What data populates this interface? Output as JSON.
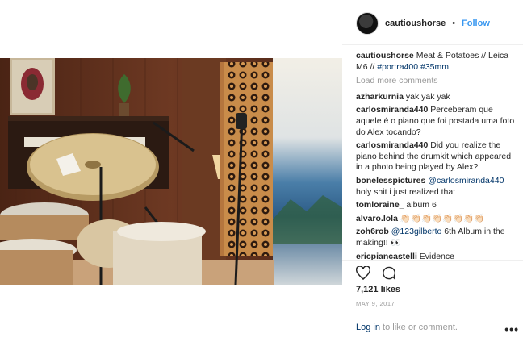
{
  "header": {
    "username": "cautioushorse",
    "separator": "•",
    "follow_label": "Follow"
  },
  "caption": {
    "username": "cautioushorse",
    "text_prefix": " Meat & Potatoes // Leica M6 // ",
    "tag1": "#portra400",
    "tag2": "#35mm"
  },
  "load_more": "Load more comments",
  "comments": [
    {
      "user": "azharkurnia",
      "text": " yak yak yak"
    },
    {
      "user": "carlosmiranda440",
      "text": " Perceberam que aquele é o piano que foi postada uma foto do Alex tocando?"
    },
    {
      "user": "carlosmiranda440",
      "text": " Did you realize the piano behind the drumkit which appeared in a photo being played by Alex?"
    },
    {
      "user": "bonelesspictures",
      "mention": "@carlosmiranda440",
      "text": " holy shit i just realized that"
    },
    {
      "user": "tomloraine_",
      "text": " album 6"
    },
    {
      "user": "alvaro.lola",
      "text": " 👏🏻👏🏻👏🏻👏🏻👏🏻👏🏻👏🏻👏🏻"
    },
    {
      "user": "zoh6rob",
      "mention": "@123gilberto",
      "text": " 6th Album in the making!! 👀"
    },
    {
      "user": "ericpiancastelli",
      "text": " Evidence"
    }
  ],
  "likes": "7,121 likes",
  "date": "MAY 9, 2017",
  "footer": {
    "login_label": "Log in",
    "login_suffix": " to like or comment.",
    "more_label": "•••"
  }
}
